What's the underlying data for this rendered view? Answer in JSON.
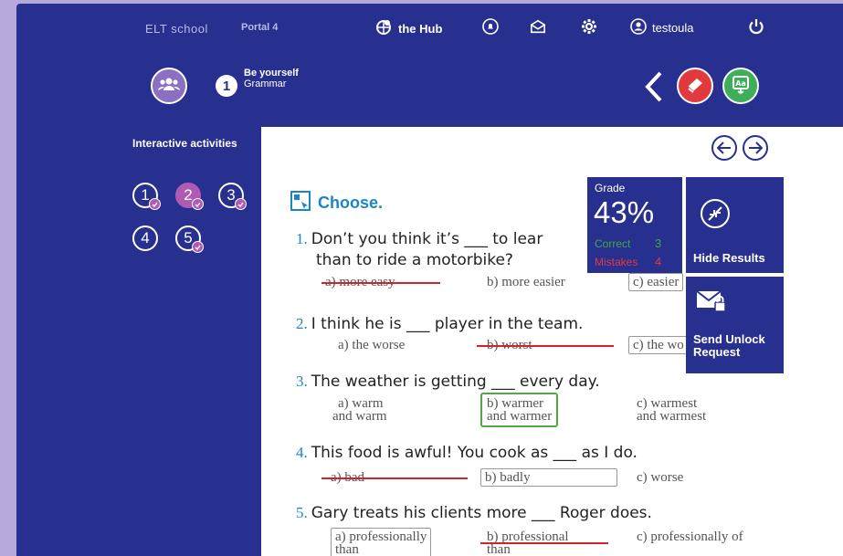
{
  "topbar": {
    "school": "ELT school",
    "portal": "Portal 4",
    "hub": "the Hub",
    "username": "testoula",
    "icons": [
      "hub-icon",
      "bell-icon",
      "mail-icon",
      "gear-icon",
      "user-icon",
      "power-icon"
    ]
  },
  "unit": {
    "number": "1",
    "title": "Be yourself",
    "subtitle": "Grammar"
  },
  "sidebar": {
    "title": "Interactive activities",
    "activities": [
      "1",
      "2",
      "3",
      "4",
      "5"
    ]
  },
  "exercise": {
    "heading": "Choose.",
    "questions": [
      {
        "num": "1.",
        "line1": "Don’t you think it’s ___ to lear",
        "line2": "than to ride a motorbike?",
        "a": "a) more easy",
        "b": "b) more easier",
        "c": "c) easier"
      },
      {
        "num": "2.",
        "line1": "I think he is ___ player in the team.",
        "a": "a) the worse",
        "b": "b) worst",
        "c": "c) the wo"
      },
      {
        "num": "3.",
        "line1": "The weather is getting ___ every day.",
        "a1": "a) warm",
        "a2": "and warm",
        "b1": "b) warmer",
        "b2": "and warmer",
        "c1": "c) warmest",
        "c2": "and warmest"
      },
      {
        "num": "4.",
        "line1": "This food is awful! You cook as ___ as I do.",
        "a": "a) bad",
        "b": "b) badly",
        "c": "c) worse"
      },
      {
        "num": "5.",
        "line1": "Gary treats his clients more ___ Roger does.",
        "a1": "a) professionally",
        "a2": "than",
        "b1": "b) professional",
        "b2": "than",
        "c1": "c) professionally of"
      }
    ]
  },
  "results": {
    "grade_label": "Grade",
    "grade_value": "43%",
    "correct_label": "Correct",
    "correct_value": "3",
    "mistakes_label": "Mistakes",
    "mistakes_value": "4",
    "hide_label": "Hide Results",
    "send_label": "Send Unlock Request"
  },
  "colors": {
    "navy": "#28308f",
    "purple": "#b05bb3",
    "red": "#e2393f",
    "green": "#3fae5a",
    "blue": "#1b85c7"
  }
}
